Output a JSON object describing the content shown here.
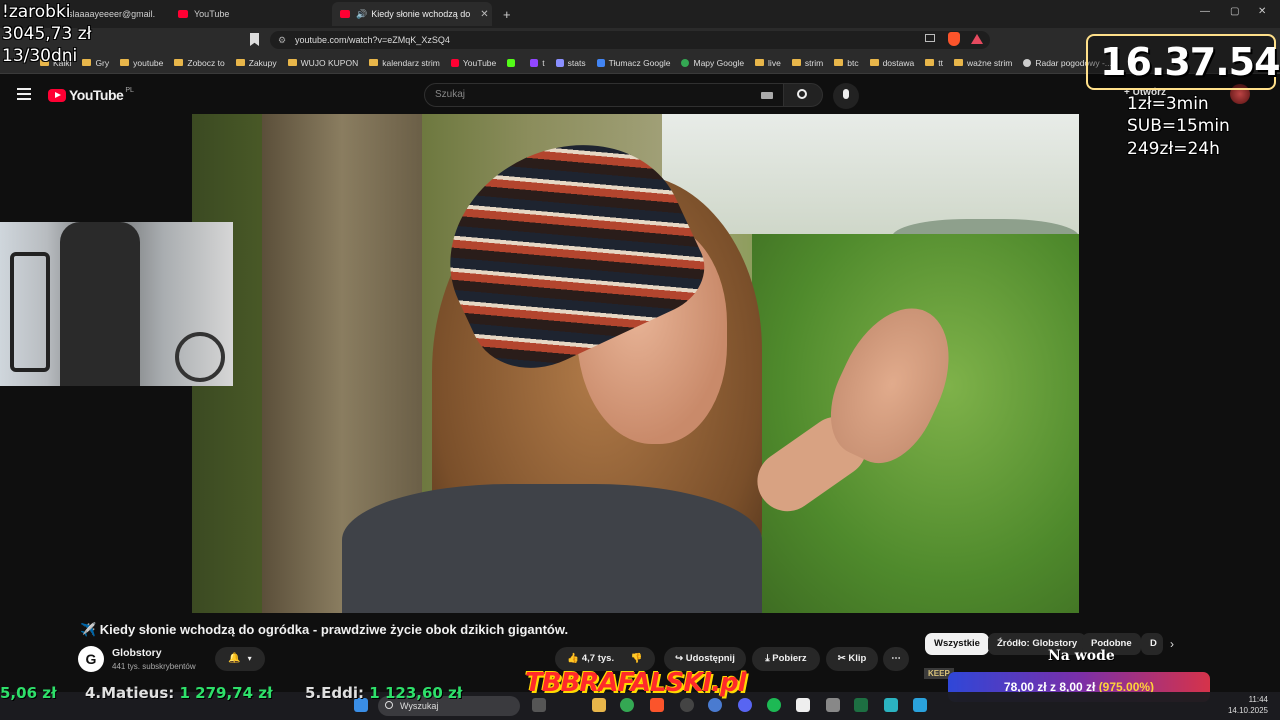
{
  "browser": {
    "tabs": [
      {
        "label": "slaaaayeeeer@gmail."
      },
      {
        "label": "YouTube"
      },
      {
        "label": "Kiedy słonie wchodzą do"
      }
    ],
    "new_tab": "+",
    "url": "youtube.com/watch?v=eZMqK_XzSQ4",
    "bookmarks": [
      "Kalki",
      "Gry",
      "youtube",
      "Zobocz to",
      "Zakupy",
      "WUJO KUPON",
      "kalendarz strim",
      "YouTube",
      "t",
      "stats",
      "Tłumacz Google",
      "Mapy Google",
      "live",
      "strim",
      "btc",
      "dostawa",
      "tt",
      "ważne strim",
      "Radar pogodowy -..."
    ]
  },
  "youtube": {
    "logo": "YouTube",
    "logo_region": "PL",
    "search_placeholder": "Szukaj",
    "create_label": "Utwórz",
    "video_title": "✈️ Kiedy słonie wchodzą do ogródka - prawdziwe życie obok dzikich gigantów.",
    "channel": {
      "name": "Globstory",
      "subs": "441 tys. subskrybentów",
      "avatar_letter": "G"
    },
    "actions": {
      "likes": "4,7 tys.",
      "share": "Udostępnij",
      "download": "Pobierz",
      "clip": "Klip",
      "more": "⋯"
    },
    "chips": [
      "Wszystkie",
      "Źródło: Globstory",
      "Podobne",
      "D"
    ]
  },
  "overlays": {
    "earnings_label": "!zarobki",
    "earnings_value": "3045,73 zł",
    "days": "13/30dni",
    "clock": "16.37.54",
    "rules": [
      "1zł=3min",
      "SUB=15min",
      "249zł=24h"
    ],
    "donation": {
      "current": "78,00 zł",
      "of": "z",
      "goal": "8,00 zł",
      "percent": "(975.00%)"
    },
    "keep_label": "KEEP",
    "na_wode": "Na wode",
    "logo": "TBBRAFALSKI.pl",
    "ticker": [
      {
        "name": "",
        "amount": "5,06 zł"
      },
      {
        "name": "4.Matieus:",
        "amount": "1 279,74 zł"
      },
      {
        "name": "5.Eddi:",
        "amount": "1 123,60 zł"
      }
    ]
  },
  "taskbar": {
    "search": "Wyszukaj",
    "time": "11:44",
    "date": "14.10.2025"
  },
  "colors": {
    "accent_red": "#ff0033",
    "ticker_green": "#2ee06a",
    "clock_border": "#ffe08a"
  }
}
